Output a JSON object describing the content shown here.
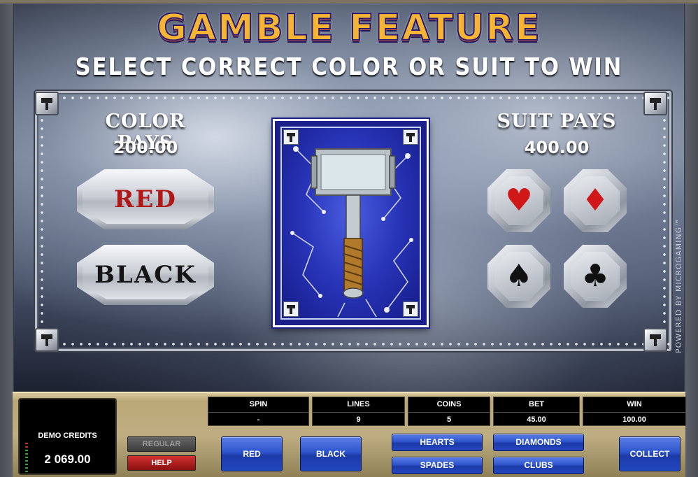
{
  "header": {
    "title": "GAMBLE FEATURE",
    "subtitle": "SELECT CORRECT COLOR OR SUIT TO WIN"
  },
  "gamble": {
    "color_pays_label": "COLOR PAYS",
    "color_pays_value": "200.00",
    "suit_pays_label": "SUIT PAYS",
    "suit_pays_value": "400.00",
    "color_buttons": [
      {
        "label": "RED",
        "color": "#b01818"
      },
      {
        "label": "BLACK",
        "color": "#151515"
      }
    ],
    "suit_buttons": [
      {
        "suit": "hearts",
        "glyph": "♥",
        "color": "#d01818"
      },
      {
        "suit": "diamonds",
        "glyph": "♦",
        "color": "#d01818"
      },
      {
        "suit": "spades",
        "glyph": "♠",
        "color": "#111111"
      },
      {
        "suit": "clubs",
        "glyph": "♣",
        "color": "#111111"
      }
    ],
    "card_back_icon": "hammer-icon"
  },
  "branding": {
    "powered_by": "POWERED BY MICROGAMING™"
  },
  "console": {
    "credits_label": "DEMO CREDITS",
    "credits_value": "2 069.00",
    "stats": [
      {
        "label": "SPIN",
        "value": "-"
      },
      {
        "label": "LINES",
        "value": "9"
      },
      {
        "label": "COINS",
        "value": "5"
      },
      {
        "label": "BET",
        "value": "45.00"
      },
      {
        "label": "WIN",
        "value": "100.00"
      }
    ],
    "regular_label": "REGULAR",
    "help_label": "HELP",
    "red_label": "RED",
    "black_label": "BLACK",
    "hearts_label": "HEARTS",
    "spades_label": "SPADES",
    "diamonds_label": "DIAMONDS",
    "clubs_label": "CLUBS",
    "collect_label": "COLLECT"
  },
  "colors": {
    "title_gold": "#f5b533",
    "button_blue": "#2e54cc",
    "help_red": "#d23030",
    "console_gold": "#bfae82"
  }
}
